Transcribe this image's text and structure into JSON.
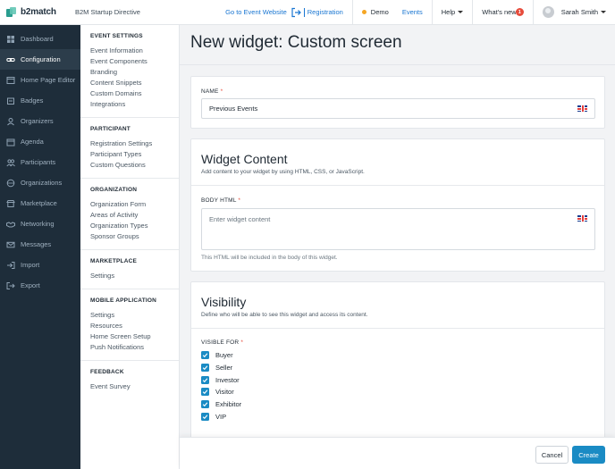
{
  "topbar": {
    "brand": "b2match",
    "event_name": "B2M Startup Directive",
    "goto_event": "Go to Event Website",
    "registration": "Registration",
    "demo": "Demo",
    "events": "Events",
    "help": "Help",
    "whats_new": "What's new",
    "whats_new_count": "1",
    "user_name": "Sarah Smith"
  },
  "leftnav": {
    "items": [
      {
        "label": "Dashboard",
        "icon": "dashboard-icon"
      },
      {
        "label": "Configuration",
        "icon": "link-icon"
      },
      {
        "label": "Home Page Editor",
        "icon": "browser-icon"
      },
      {
        "label": "Badges",
        "icon": "badge-icon"
      },
      {
        "label": "Organizers",
        "icon": "people-icon"
      },
      {
        "label": "Agenda",
        "icon": "calendar-icon"
      },
      {
        "label": "Participants",
        "icon": "users-icon"
      },
      {
        "label": "Organizations",
        "icon": "building-icon"
      },
      {
        "label": "Marketplace",
        "icon": "shop-icon"
      },
      {
        "label": "Networking",
        "icon": "handshake-icon"
      },
      {
        "label": "Messages",
        "icon": "envelope-icon"
      },
      {
        "label": "Import",
        "icon": "import-icon"
      },
      {
        "label": "Export",
        "icon": "export-icon"
      }
    ]
  },
  "subnav": {
    "sections": [
      {
        "title": "EVENT SETTINGS",
        "links": [
          "Event Information",
          "Event Components",
          "Branding",
          "Content Snippets",
          "Custom Domains",
          "Integrations"
        ]
      },
      {
        "title": "PARTICIPANT",
        "links": [
          "Registration Settings",
          "Participant Types",
          "Custom Questions"
        ]
      },
      {
        "title": "ORGANIZATION",
        "links": [
          "Organization Form",
          "Areas of Activity",
          "Organization Types",
          "Sponsor Groups"
        ]
      },
      {
        "title": "MARKETPLACE",
        "links": [
          "Settings"
        ]
      },
      {
        "title": "MOBILE APPLICATION",
        "links": [
          "Settings",
          "Resources",
          "Home Screen Setup",
          "Push Notifications"
        ]
      },
      {
        "title": "FEEDBACK",
        "links": [
          "Event Survey"
        ]
      }
    ]
  },
  "main": {
    "title": "New widget: Custom screen",
    "name_label": "NAME",
    "name_value": "Previous Events",
    "content_title": "Widget Content",
    "content_sub": "Add content to your widget by using HTML, CSS, or JavaScript.",
    "body_label": "BODY HTML",
    "body_placeholder": "Enter widget content",
    "body_help": "This HTML will be included in the body of this widget.",
    "visibility_title": "Visibility",
    "visibility_sub": "Define who will be able to see this widget and access its content.",
    "visible_for_label": "VISIBLE FOR",
    "visible_for": [
      "Buyer",
      "Seller",
      "Investor",
      "Visitor",
      "Exhibitor",
      "VIP"
    ]
  },
  "footer": {
    "cancel": "Cancel",
    "create": "Create"
  },
  "colors": {
    "accent": "#1a8bc4",
    "link": "#1976d2",
    "nav_bg": "#1e2d3a",
    "required": "#e74c3c"
  }
}
